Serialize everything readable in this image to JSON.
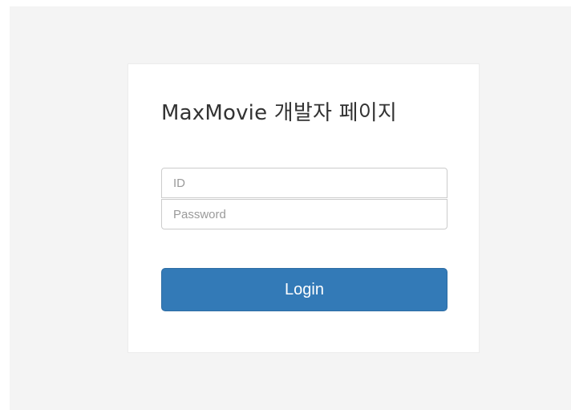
{
  "login": {
    "title": "MaxMovie 개발자 페이지",
    "id_placeholder": "ID",
    "id_value": "",
    "password_placeholder": "Password",
    "password_value": "",
    "button_label": "Login"
  },
  "colors": {
    "page_background": "#f4f4f4",
    "card_background": "#ffffff",
    "button_primary": "#337ab7",
    "button_text": "#ffffff"
  }
}
